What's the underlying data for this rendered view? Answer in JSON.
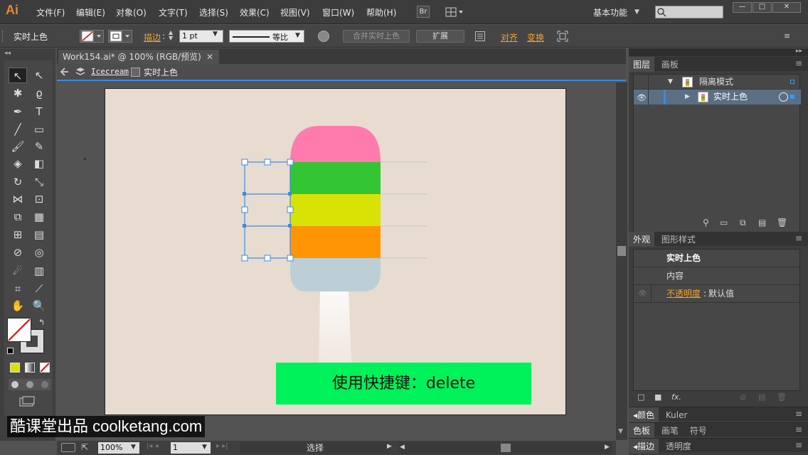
{
  "app": {
    "logo": "Ai",
    "workspace": "基本功能"
  },
  "menu": [
    "文件(F)",
    "编辑(E)",
    "对象(O)",
    "文字(T)",
    "选择(S)",
    "效果(C)",
    "视图(V)",
    "窗口(W)",
    "帮助(H)"
  ],
  "control": {
    "object_label": "实时上色",
    "stroke_label": "描边",
    "stroke_weight": "1 pt",
    "profile_label": "等比",
    "merge_label": "合并实时上色",
    "expand_label": "扩展",
    "align_label": "对齐",
    "transform_label": "变换"
  },
  "document": {
    "tab_title": "Work154.ai* @ 100% (RGB/预览)",
    "breadcrumb_layer": "Icecream",
    "breadcrumb_object": "实时上色"
  },
  "status": {
    "zoom": "100%",
    "page": "1",
    "tool": "选择"
  },
  "layers_panel": {
    "tabs": [
      "图层",
      "画板"
    ],
    "rows": [
      "隔离模式",
      "实时上色"
    ]
  },
  "appearance_panel": {
    "tabs": [
      "外观",
      "图形样式"
    ],
    "title": "实时上色",
    "content": "内容",
    "opacity_label": "不透明度",
    "opacity_value": "默认值"
  },
  "collapsed_panels": [
    [
      "颜色",
      "Kuler"
    ],
    [
      "色板",
      "画笔",
      "符号"
    ],
    [
      "描边",
      "透明度"
    ]
  ],
  "canvas_caption": "使用快捷键：delete",
  "watermark": "酷课堂出品 coolketang.com",
  "colors": {
    "pink": "#ff7bae",
    "green": "#33c532",
    "yellow": "#d9e205",
    "orange": "#ff9404",
    "lightblue": "#bccfd6",
    "caption_bg": "#00f25a"
  }
}
